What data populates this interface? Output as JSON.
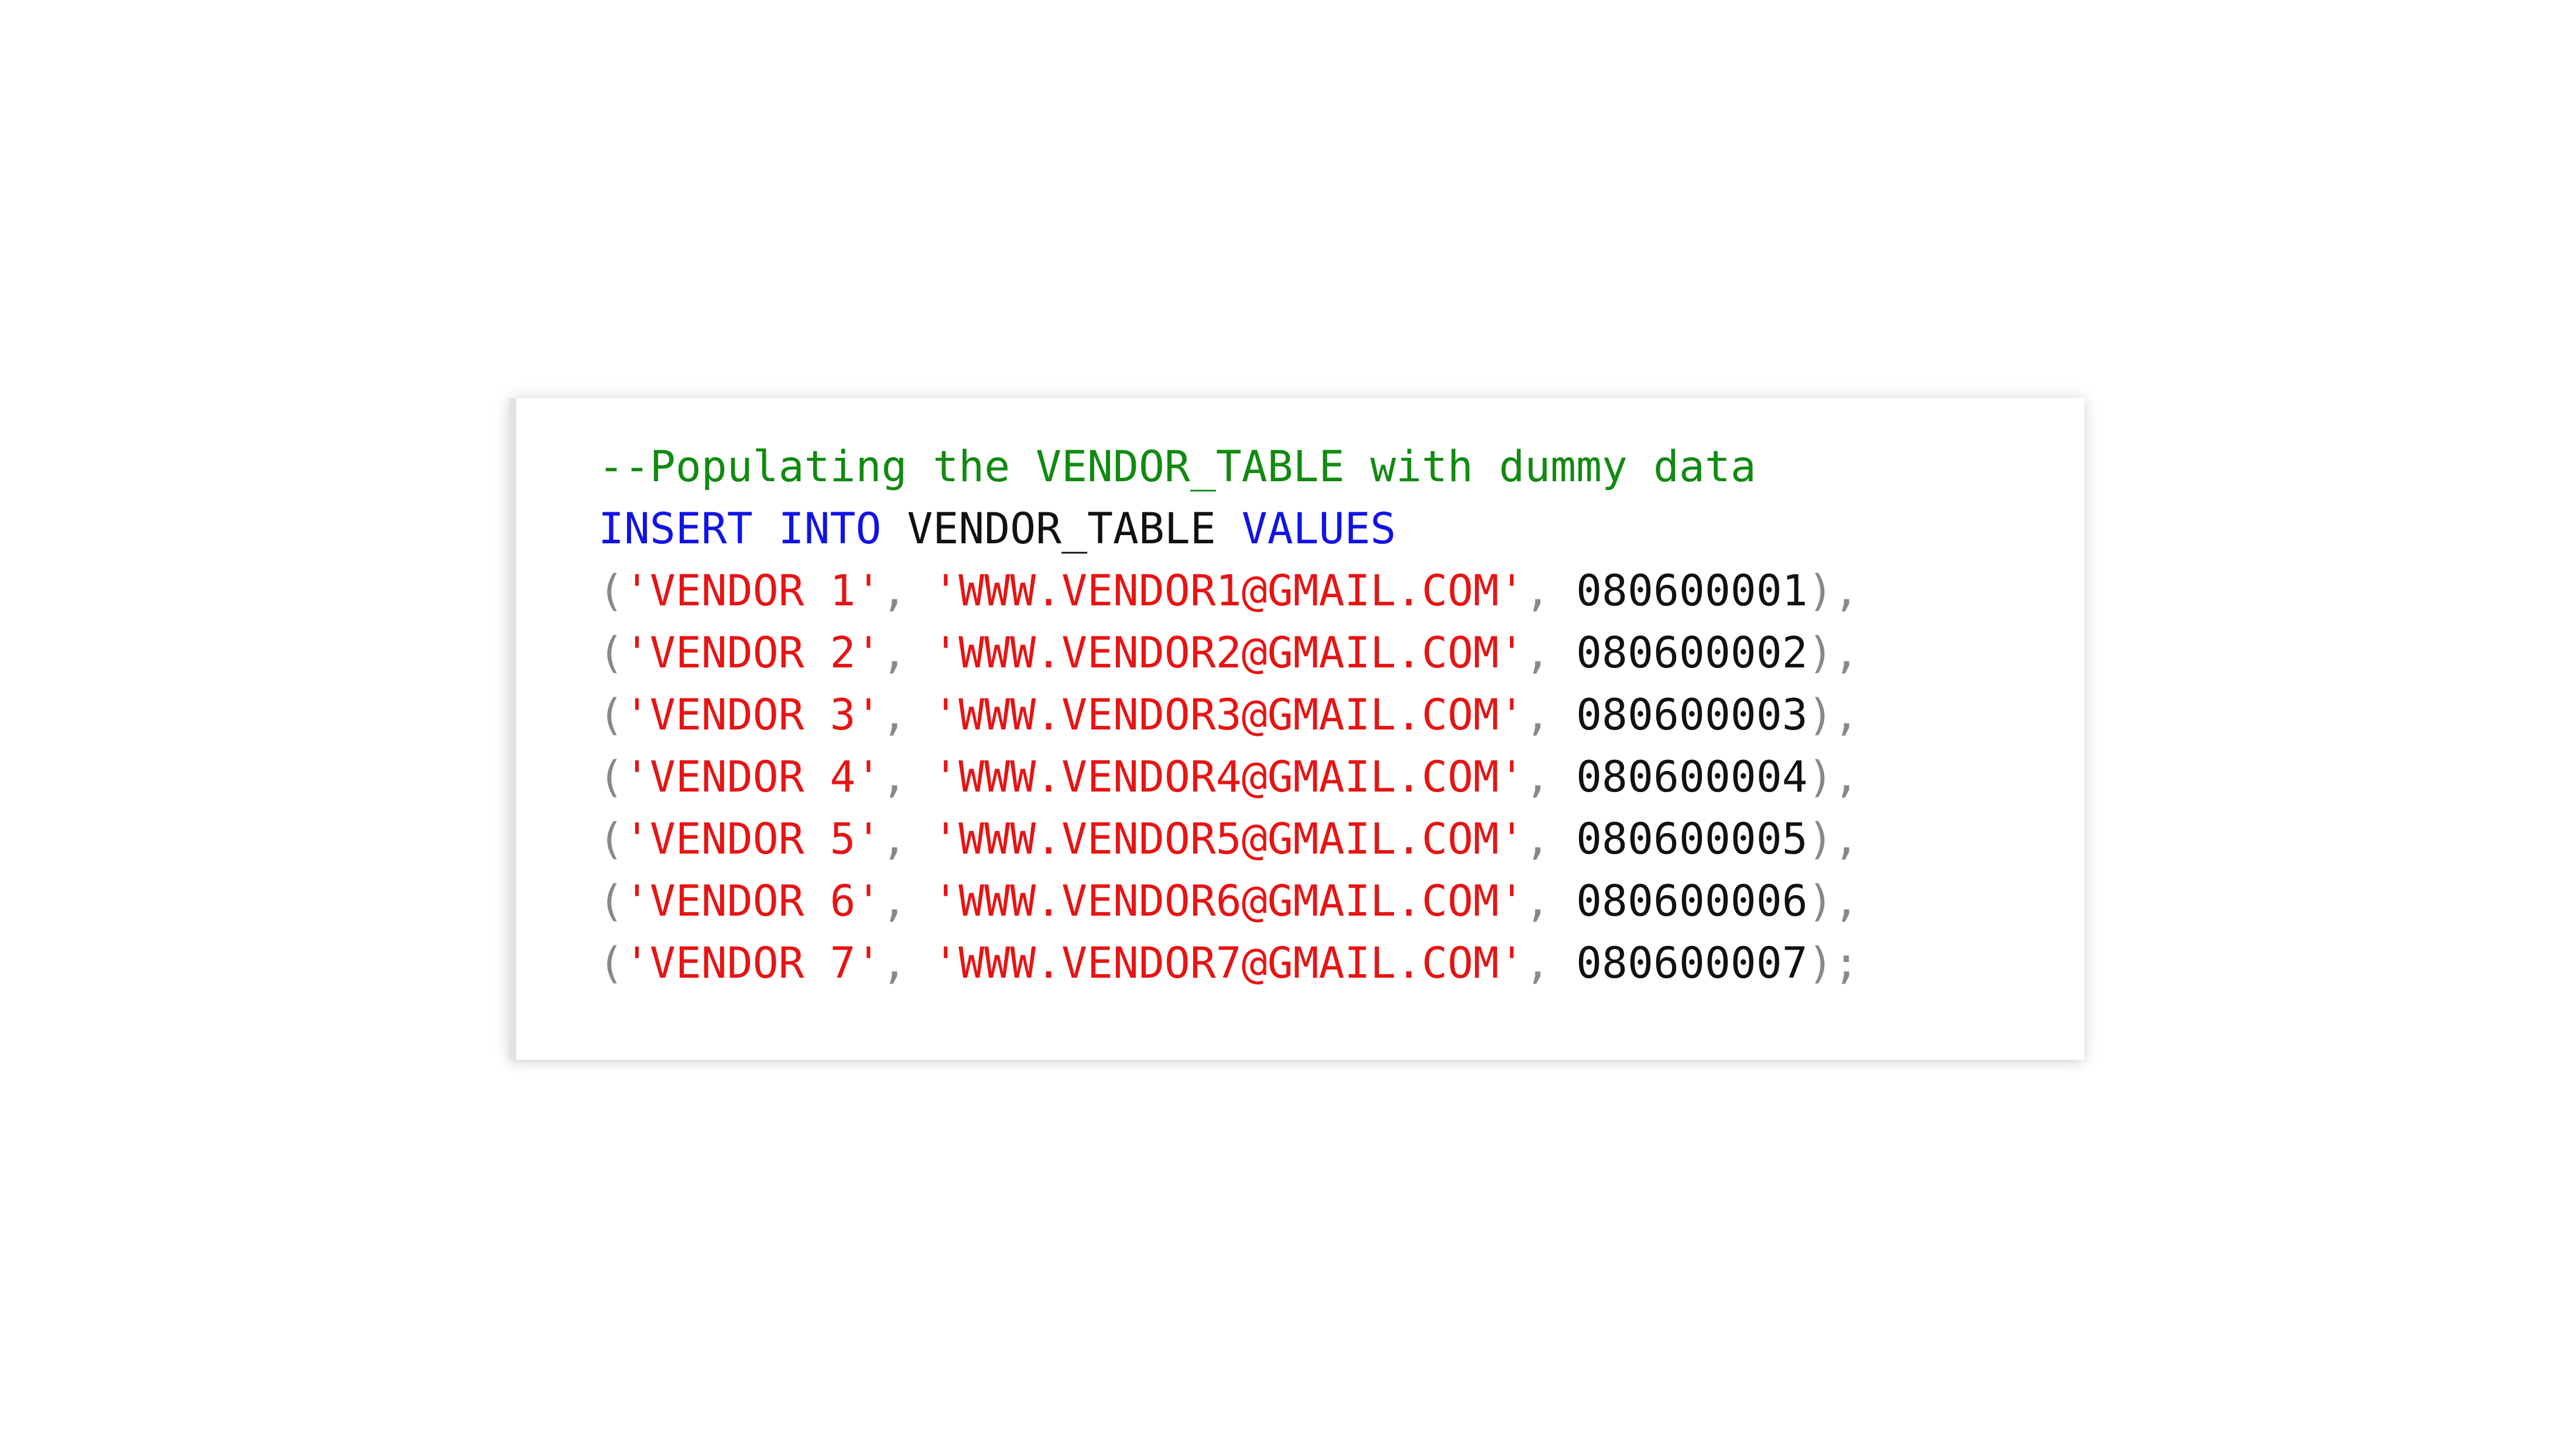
{
  "code": {
    "comment": "--Populating the VENDOR_TABLE with dummy data",
    "insert_keyword": "INSERT",
    "into_keyword": "INTO",
    "table_name": "VENDOR_TABLE",
    "values_keyword": "VALUES",
    "rows": [
      {
        "name": "'VENDOR 1'",
        "email": "'WWW.VENDOR1@GMAIL.COM'",
        "phone": "080600001",
        "terminator": "),"
      },
      {
        "name": "'VENDOR 2'",
        "email": "'WWW.VENDOR2@GMAIL.COM'",
        "phone": "080600002",
        "terminator": "),"
      },
      {
        "name": "'VENDOR 3'",
        "email": "'WWW.VENDOR3@GMAIL.COM'",
        "phone": "080600003",
        "terminator": "),"
      },
      {
        "name": "'VENDOR 4'",
        "email": "'WWW.VENDOR4@GMAIL.COM'",
        "phone": "080600004",
        "terminator": "),"
      },
      {
        "name": "'VENDOR 5'",
        "email": "'WWW.VENDOR5@GMAIL.COM'",
        "phone": "080600005",
        "terminator": "),"
      },
      {
        "name": "'VENDOR 6'",
        "email": "'WWW.VENDOR6@GMAIL.COM'",
        "phone": "080600006",
        "terminator": "),"
      },
      {
        "name": "'VENDOR 7'",
        "email": "'WWW.VENDOR7@GMAIL.COM'",
        "phone": "080600007",
        "terminator": ");"
      }
    ]
  },
  "colors": {
    "comment": "#118a11",
    "keyword": "#1212e6",
    "string": "#e61414",
    "number": "#111111",
    "punctuation": "#888888"
  }
}
